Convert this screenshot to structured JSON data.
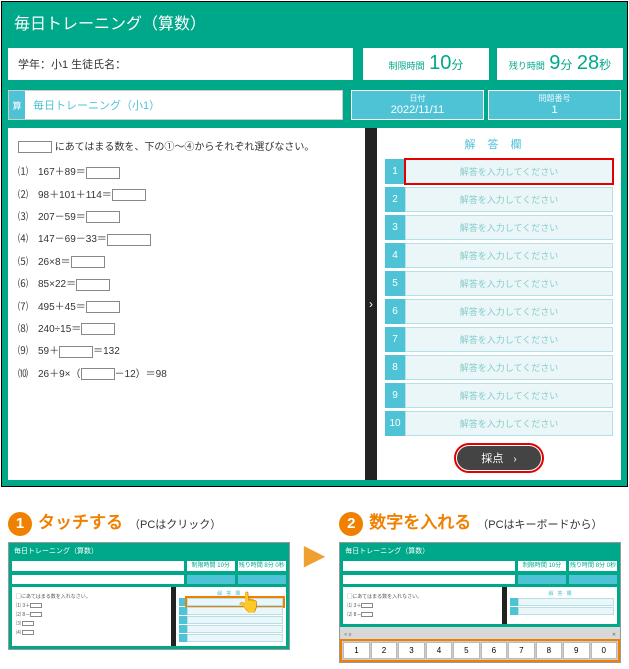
{
  "header": {
    "title": "毎日トレーニング（算数）"
  },
  "student_bar": {
    "grade_label": "学年：小1  生徒氏名："
  },
  "time_limit": {
    "label": "制限時間",
    "value": "10",
    "unit": "分"
  },
  "time_remain": {
    "label": "残り時間",
    "min": "9",
    "min_unit": "分",
    "sec": "28",
    "sec_unit": "秒"
  },
  "nav": {
    "tag": "算",
    "title": "毎日トレーニング（小1）",
    "date_label": "日付",
    "date_value": "2022/11/11",
    "qnum_label": "問題番号",
    "qnum_value": "1"
  },
  "problems": {
    "intro": "▢ にあてはまる数を、下の①～④からそれぞれ選びなさい。",
    "items": [
      "⑴　167＋89＝▢",
      "⑵　98＋101＋114＝▢",
      "⑶　207－59＝▢",
      "⑷　147－69－33＝▢",
      "⑸　26×8＝▢",
      "⑹　85×22＝▢",
      "⑺　495＋45＝▢",
      "⑻　240÷15＝▢",
      "⑼　59＋▢＝132",
      "⑽　26＋9×（▢－12）＝98"
    ]
  },
  "answer_panel": {
    "header": "解答欄",
    "placeholder": "解答を入力してください",
    "rows": [
      "1",
      "2",
      "3",
      "4",
      "5",
      "6",
      "7",
      "8",
      "9",
      "10"
    ],
    "score_button": "採点"
  },
  "instructions": {
    "step1_title": "タッチする",
    "step1_sub": "（PCはクリック）",
    "step2_title": "数字を入れる",
    "step2_sub": "（PCはキーボードから）",
    "thumb_header": "毎日トレーニング（算数）",
    "thumb_time1_label": "制限時間",
    "thumb_time1": "10分",
    "thumb_time2_label": "残り時間",
    "thumb_time2": "8分 0秒",
    "thumb_prob_intro": "▢にあてはまる数を入れなさい。",
    "keys": [
      "1",
      "2",
      "3",
      "4",
      "5",
      "6",
      "7",
      "8",
      "9",
      "0"
    ]
  }
}
